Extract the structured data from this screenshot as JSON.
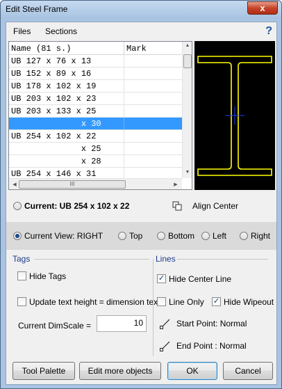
{
  "window": {
    "title": "Edit Steel Frame",
    "close_glyph": "x"
  },
  "menu": {
    "files": "Files",
    "sections": "Sections",
    "help": "?"
  },
  "list": {
    "columns": [
      "Name  (81 s.)",
      "Mark"
    ],
    "rows": [
      "UB 127 x 76 x 13",
      "UB 152 x 89 x 16",
      "UB 178 x 102 x 19",
      "UB 203 x 102 x 23",
      "UB 203 x 133 x 25",
      "              x 30",
      "UB 254 x 102 x 22",
      "              x 25",
      "              x 28",
      "UB 254 x 146 x 31"
    ],
    "selected_index": 5,
    "hscroll_grip": "III"
  },
  "current": {
    "label": "Current: UB 254 x 102 x 22",
    "align": "Align Center"
  },
  "view": {
    "current": "Current View: RIGHT",
    "top": "Top",
    "bottom": "Bottom",
    "left": "Left",
    "right": "Right"
  },
  "tags": {
    "title": "Tags",
    "hide_tags": "Hide Tags",
    "update_text": "Update text height = dimension text",
    "dimscale_label": "Current DimScale =",
    "dimscale_value": "10"
  },
  "lines": {
    "title": "Lines",
    "hide_center": "Hide Center Line",
    "line_only": "Line Only",
    "hide_wipeout": "Hide Wipeout",
    "start_point": "Start Point: Normal",
    "end_point": "End Point : Normal"
  },
  "buttons": {
    "tool_palette": "Tool Palette",
    "edit_more": "Edit more objects",
    "ok": "OK",
    "cancel": "Cancel"
  },
  "colors": {
    "selection": "#3399ff",
    "section_outline": "#ffff00",
    "section_center": "#1e3cff",
    "preview_bg": "#000000"
  }
}
